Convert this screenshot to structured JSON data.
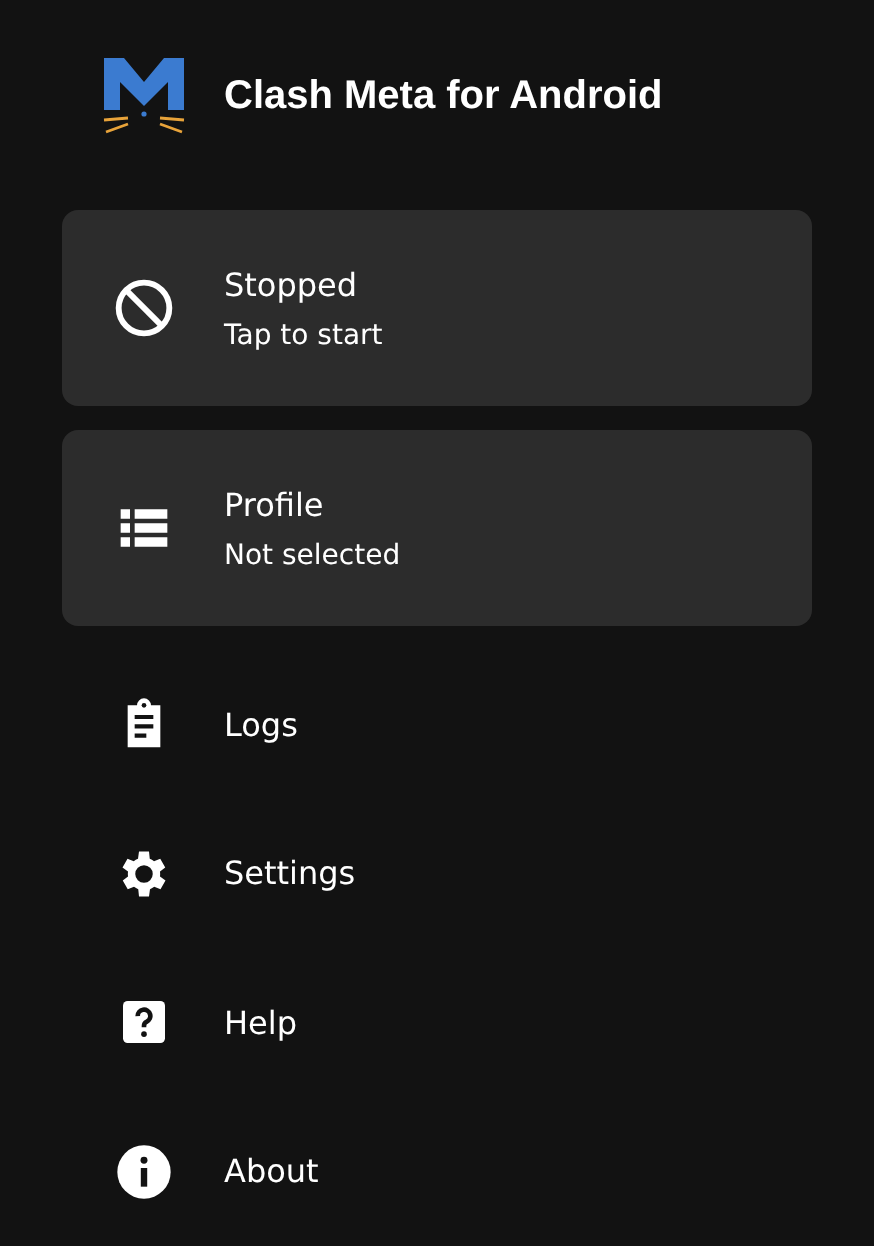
{
  "app": {
    "title": "Clash Meta for Android"
  },
  "cards": [
    {
      "title": "Stopped",
      "subtitle": "Tap to start"
    },
    {
      "title": "Profile",
      "subtitle": "Not selected"
    }
  ],
  "menu": [
    {
      "label": "Logs"
    },
    {
      "label": "Settings"
    },
    {
      "label": "Help"
    },
    {
      "label": "About"
    }
  ]
}
